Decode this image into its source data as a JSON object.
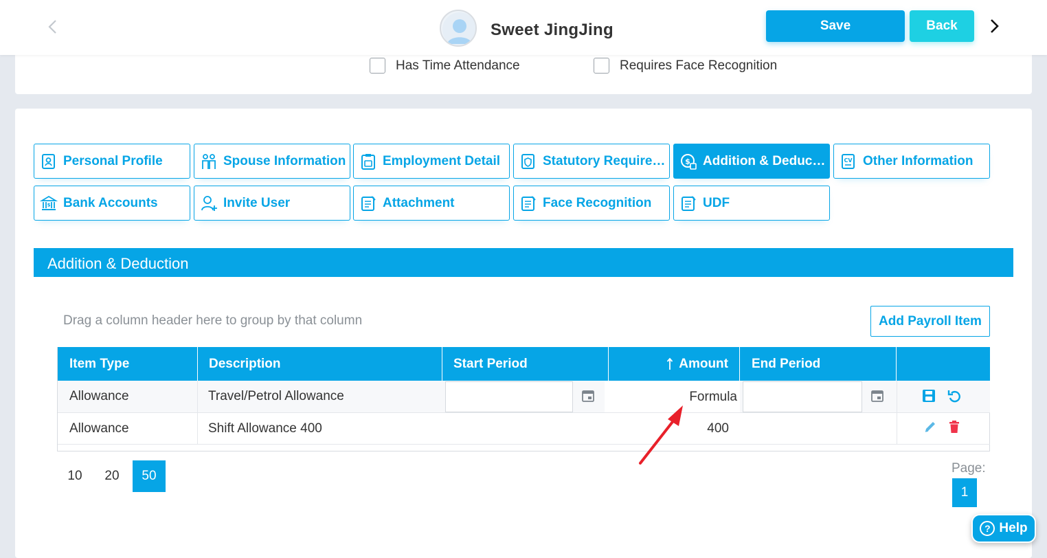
{
  "header": {
    "user_name": "Sweet JingJing",
    "save_label": "Save",
    "back_label": "Back"
  },
  "checkboxes": [
    {
      "label": "Has Time Attendance",
      "checked": false
    },
    {
      "label": "Requires Face Recognition",
      "checked": false
    }
  ],
  "tabs": [
    {
      "label": "Personal Profile",
      "icon": "personal-profile-icon",
      "active": false
    },
    {
      "label": "Spouse Information",
      "icon": "spouse-icon",
      "active": false
    },
    {
      "label": "Employment Detail",
      "icon": "employment-icon",
      "active": false
    },
    {
      "label": "Statutory Requirements",
      "icon": "statutory-icon",
      "active": false
    },
    {
      "label": "Addition & Deduction",
      "icon": "addition-deduction-icon",
      "active": true
    },
    {
      "label": "Other Information",
      "icon": "cv-icon",
      "active": false
    },
    {
      "label": "Bank Accounts",
      "icon": "bank-icon",
      "active": false
    },
    {
      "label": "Invite User",
      "icon": "invite-user-icon",
      "active": false
    },
    {
      "label": "Attachment",
      "icon": "document-icon",
      "active": false
    },
    {
      "label": "Face Recognition",
      "icon": "document-icon",
      "active": false
    },
    {
      "label": "UDF",
      "icon": "document-icon",
      "active": false
    }
  ],
  "section": {
    "title": "Addition & Deduction",
    "group_hint": "Drag a column header here to group by that column",
    "add_button": "Add Payroll Item"
  },
  "grid": {
    "columns": [
      "Item Type",
      "Description",
      "Start Period",
      "Amount",
      "End Period"
    ],
    "sort_column": "Amount",
    "sort_direction": "ascending",
    "rows": [
      {
        "item_type": "Allowance",
        "description": "Travel/Petrol Allowance",
        "start_period": "",
        "amount": "Formula",
        "end_period": "",
        "mode": "edit"
      },
      {
        "item_type": "Allowance",
        "description": "Shift Allowance 400",
        "start_period": "",
        "amount": "400",
        "end_period": "",
        "mode": "view"
      }
    ]
  },
  "pager": {
    "sizes": [
      "10",
      "20",
      "50"
    ],
    "active_size": "50",
    "page_label": "Page:",
    "current_page": "1"
  },
  "help_label": "Help",
  "colors": {
    "primary": "#06a5e6",
    "back_button": "#1ed0e3",
    "delete": "#f0344b",
    "annotation_arrow": "#e8202a"
  }
}
